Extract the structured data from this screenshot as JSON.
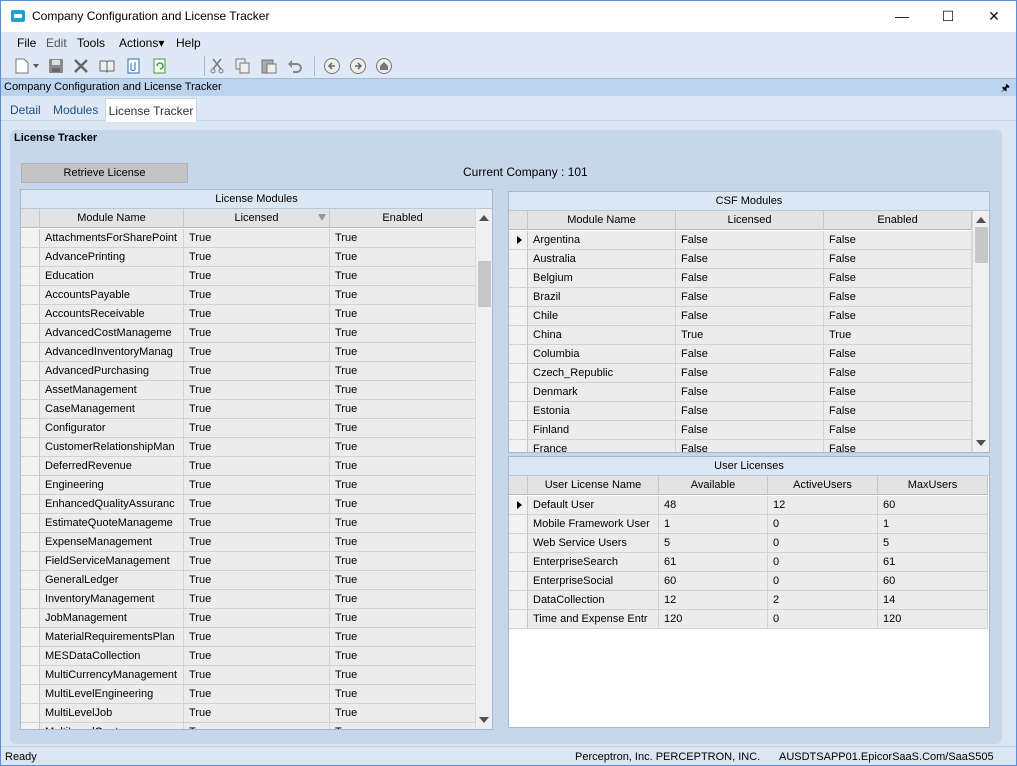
{
  "window": {
    "title": "Company Configuration and License Tracker",
    "minimize": "—",
    "maximize": "☐",
    "close": "✕"
  },
  "menu": [
    {
      "label": "File",
      "mnemonic": "F"
    },
    {
      "label": "Edit",
      "mnemonic": "E"
    },
    {
      "label": "Tools",
      "mnemonic": "T"
    },
    {
      "label": "Actions▾",
      "mnemonic": ""
    },
    {
      "label": "Help",
      "mnemonic": "H"
    }
  ],
  "toolbar_icons": [
    "new-icon",
    "save-icon",
    "delete-icon",
    "book-icon",
    "attach-icon",
    "refresh-icon",
    "cut-icon",
    "copy-icon",
    "paste-icon",
    "undo-icon",
    "back-icon",
    "forward-icon",
    "home-icon"
  ],
  "panel": {
    "title": "Company Configuration and License Tracker",
    "pin": "🖈"
  },
  "tabs": [
    "Detail",
    "Modules",
    "License Tracker"
  ],
  "active_tab": "License Tracker",
  "section_label": "License Tracker",
  "retrieve_button": "Retrieve License",
  "current_company": "Current Company : 101",
  "license_modules": {
    "title": "License Modules",
    "columns": [
      "Module Name",
      "Licensed",
      "Enabled"
    ],
    "rows": [
      [
        "AttachmentsForSharePoint",
        "True",
        "True"
      ],
      [
        "AdvancePrinting",
        "True",
        "True"
      ],
      [
        "Education",
        "True",
        "True"
      ],
      [
        "AccountsPayable",
        "True",
        "True"
      ],
      [
        "AccountsReceivable",
        "True",
        "True"
      ],
      [
        "AdvancedCostManageme",
        "True",
        "True"
      ],
      [
        "AdvancedInventoryManag",
        "True",
        "True"
      ],
      [
        "AdvancedPurchasing",
        "True",
        "True"
      ],
      [
        "AssetManagement",
        "True",
        "True"
      ],
      [
        "CaseManagement",
        "True",
        "True"
      ],
      [
        "Configurator",
        "True",
        "True"
      ],
      [
        "CustomerRelationshipMan",
        "True",
        "True"
      ],
      [
        "DeferredRevenue",
        "True",
        "True"
      ],
      [
        "Engineering",
        "True",
        "True"
      ],
      [
        "EnhancedQualityAssuranc",
        "True",
        "True"
      ],
      [
        "EstimateQuoteManageme",
        "True",
        "True"
      ],
      [
        "ExpenseManagement",
        "True",
        "True"
      ],
      [
        "FieldServiceManagement",
        "True",
        "True"
      ],
      [
        "GeneralLedger",
        "True",
        "True"
      ],
      [
        "InventoryManagement",
        "True",
        "True"
      ],
      [
        "JobManagement",
        "True",
        "True"
      ],
      [
        "MaterialRequirementsPlan",
        "True",
        "True"
      ],
      [
        "MESDataCollection",
        "True",
        "True"
      ],
      [
        "MultiCurrencyManagement",
        "True",
        "True"
      ],
      [
        "MultiLevelEngineering",
        "True",
        "True"
      ],
      [
        "MultiLevelJob",
        "True",
        "True"
      ],
      [
        "MultiLevelQuote",
        "True",
        "True"
      ]
    ]
  },
  "csf_modules": {
    "title": "CSF Modules",
    "columns": [
      "Module Name",
      "Licensed",
      "Enabled"
    ],
    "rows": [
      [
        "Argentina",
        "False",
        "False"
      ],
      [
        "Australia",
        "False",
        "False"
      ],
      [
        "Belgium",
        "False",
        "False"
      ],
      [
        "Brazil",
        "False",
        "False"
      ],
      [
        "Chile",
        "False",
        "False"
      ],
      [
        "China",
        "True",
        "True"
      ],
      [
        "Columbia",
        "False",
        "False"
      ],
      [
        "Czech_Republic",
        "False",
        "False"
      ],
      [
        "Denmark",
        "False",
        "False"
      ],
      [
        "Estonia",
        "False",
        "False"
      ],
      [
        "Finland",
        "False",
        "False"
      ],
      [
        "France",
        "False",
        "False"
      ]
    ]
  },
  "user_licenses": {
    "title": "User Licenses",
    "columns": [
      "User License Name",
      "Available",
      "ActiveUsers",
      "MaxUsers"
    ],
    "rows": [
      [
        "Default User",
        "48",
        "12",
        "60"
      ],
      [
        "Mobile Framework User",
        "1",
        "0",
        "1"
      ],
      [
        "Web Service Users",
        "5",
        "0",
        "5"
      ],
      [
        "EnterpriseSearch",
        "61",
        "0",
        "61"
      ],
      [
        "EnterpriseSocial",
        "60",
        "0",
        "60"
      ],
      [
        "DataCollection",
        "12",
        "2",
        "14"
      ],
      [
        "Time and Expense Entr",
        "120",
        "0",
        "120"
      ]
    ]
  },
  "status": {
    "ready": "Ready",
    "company": "Perceptron, Inc.  PERCEPTRON, INC.",
    "server": "AUSDTSAPP01.EpicorSaaS.Com/SaaS505"
  }
}
